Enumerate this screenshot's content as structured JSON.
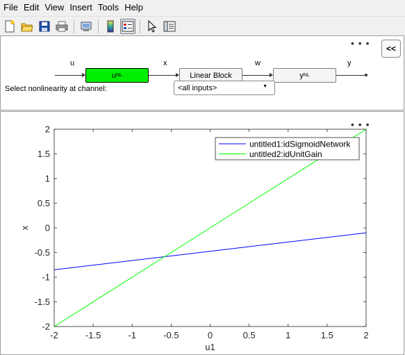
{
  "menu": [
    "File",
    "Edit",
    "View",
    "Insert",
    "Tools",
    "Help"
  ],
  "toolbar": {
    "icons": [
      "new-figure-icon",
      "open-file-icon",
      "save-icon",
      "print-icon",
      "print-preview-icon",
      "colorbar-icon",
      "legend-icon",
      "pointer-icon",
      "property-inspector-icon"
    ]
  },
  "top_panel": {
    "more_options": "• • •",
    "collapse_label": "<<",
    "signals": {
      "u": "u",
      "x": "x",
      "w": "w",
      "y": "y"
    },
    "blocks": {
      "input_nl": "u",
      "input_nl_sub": "NL",
      "linear": "Linear Block",
      "output_nl": "y",
      "output_nl_sub": "NL"
    },
    "select_label": "Select nonlinearity at channel:",
    "select_value": "<all inputs>",
    "colors": {
      "active_block": "#00ee00"
    }
  },
  "plot_panel": {
    "more_options": "• • •"
  },
  "chart_data": {
    "type": "line",
    "xlabel": "u1",
    "ylabel": "x",
    "xlim": [
      -2,
      2
    ],
    "ylim": [
      -2,
      2
    ],
    "xticks": [
      "-2",
      "-1.5",
      "-1",
      "-0.5",
      "0",
      "0.5",
      "1",
      "1.5",
      "2"
    ],
    "yticks": [
      "2",
      "1.5",
      "1",
      "0.5",
      "0",
      "-0.5",
      "-1",
      "-1.5",
      "-2"
    ],
    "xtick_values": [
      -2,
      -1.5,
      -1,
      -0.5,
      0,
      0.5,
      1,
      1.5,
      2
    ],
    "ytick_values": [
      2,
      1.5,
      1,
      0.5,
      0,
      -0.5,
      -1,
      -1.5,
      -2
    ],
    "grid": false,
    "legend_position": "top-right",
    "series": [
      {
        "name": "untitled1:idSigmoidNetwork",
        "color": "#0000ff",
        "x": [
          -2,
          2
        ],
        "y": [
          -0.85,
          -0.1
        ]
      },
      {
        "name": "untitled2:idUnitGain",
        "color": "#00ff00",
        "x": [
          -2,
          2
        ],
        "y": [
          -2,
          2
        ]
      }
    ]
  }
}
